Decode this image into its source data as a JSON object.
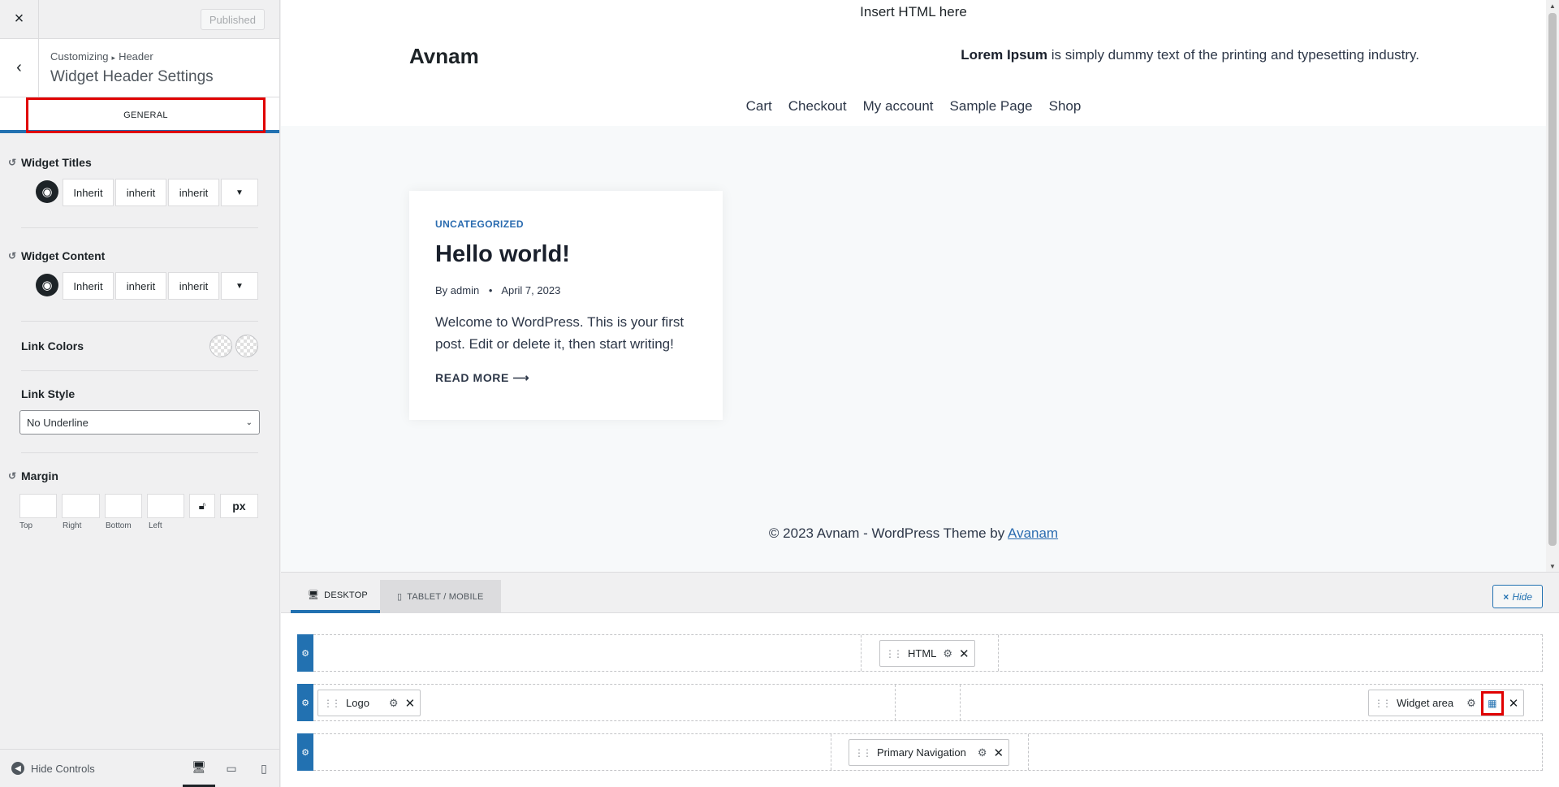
{
  "sidebar": {
    "close_icon": "×",
    "publish_label": "Published",
    "breadcrumb": [
      "Customizing",
      "Header"
    ],
    "panel_title": "Widget Header Settings",
    "tab_general": "GENERAL",
    "widget_titles": {
      "label": "Widget Titles",
      "family": "Inherit",
      "size": "inherit",
      "weight": "inherit"
    },
    "widget_content": {
      "label": "Widget Content",
      "family": "Inherit",
      "size": "inherit",
      "weight": "inherit"
    },
    "link_colors_label": "Link Colors",
    "link_style": {
      "label": "Link Style",
      "value": "No Underline"
    },
    "margin": {
      "label": "Margin",
      "labels": [
        "Top",
        "Right",
        "Bottom",
        "Left"
      ],
      "unit": "px"
    },
    "hide_controls": "Hide Controls"
  },
  "preview": {
    "html_line": "Insert HTML here",
    "site_title": "Avnam",
    "widget_bold": "Lorem Ipsum",
    "widget_rest": " is simply dummy text of the printing and typesetting industry.",
    "nav": [
      "Cart",
      "Checkout",
      "My account",
      "Sample Page",
      "Shop"
    ],
    "post": {
      "category": "UNCATEGORIZED",
      "title": "Hello world!",
      "by": "By",
      "author": "admin",
      "date": "April 7, 2023",
      "excerpt": "Welcome to WordPress. This is your first post. Edit or delete it, then start writing!",
      "read_more": "READ MORE ⟶"
    },
    "footer_text": "© 2023 Avnam - WordPress Theme by ",
    "footer_link": "Avanam"
  },
  "builder": {
    "tab_desktop": "DESKTOP",
    "tab_tablet": "TABLET / MOBILE",
    "hide_label": "Hide",
    "items": {
      "html": "HTML",
      "logo": "Logo",
      "widget_area": "Widget area",
      "primary_nav": "Primary Navigation"
    }
  },
  "colors": {
    "accent": "#2271b1",
    "highlight": "#e00000",
    "link": "#2b6cb0"
  }
}
